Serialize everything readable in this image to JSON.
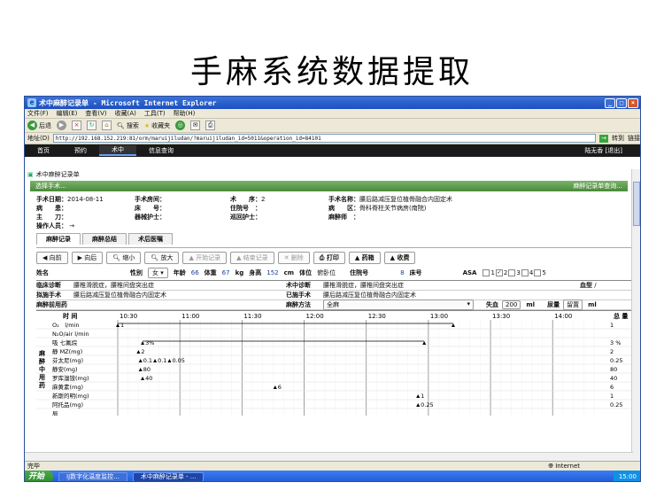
{
  "slide_title": "手麻系统数据提取",
  "window": {
    "title": "术中麻醉记录单 - Microsoft Internet Explorer"
  },
  "menu": [
    "文件(F)",
    "编辑(E)",
    "查看(V)",
    "收藏(A)",
    "工具(T)",
    "帮助(H)"
  ],
  "toolbar": {
    "back": "后退",
    "search": "搜索",
    "favorites": "收藏夹"
  },
  "address": {
    "label": "地址(D)",
    "url": "http://192.168.152.219:81/orm/maruijiludan/?maruijiludan_id=5011&operation_id=84101",
    "go": "转到",
    "links": "链接"
  },
  "nav": {
    "items": [
      "首页",
      "预约",
      "术中",
      "信息查询"
    ],
    "active": 2,
    "user": "陆无香 [退出]"
  },
  "breadcrumb": "术中麻醉记录单",
  "select_bar": {
    "left": "选择手术...",
    "right": "麻醉记录单查询..."
  },
  "surgery": {
    "date_label": "手术日期：",
    "date": "2014-08-11",
    "room_label": "手术房间：",
    "seq_label": "术　　序：",
    "seq": "2",
    "name_label": "手术名称：",
    "name": "腰后路减压复位植骨融合内固定术",
    "ward_label": "病　　患：",
    "bed_label": "床　　号：",
    "inpatient_label": "住院号　：",
    "area_label": "病　　区：",
    "area": "骨科脊柱关节病房(南院)",
    "surgeon_label": "主　　刀：",
    "instr_nurse_label": "器械护士：",
    "circ_nurse_label": "巡回护士：",
    "anes_label": "麻醉师　：",
    "operator_label": "操作人员：",
    "operator": "→"
  },
  "tabs": [
    "麻醉记录",
    "麻醉总结",
    "术后医嘱"
  ],
  "buttons": [
    "向前",
    "向后",
    "缩小",
    "放大",
    "开始记录",
    "结束记录",
    "删除",
    "打印",
    "药箱",
    "收费"
  ],
  "patient": {
    "name_label": "姓名",
    "sex_label": "性别",
    "sex": "女",
    "age_label": "年龄",
    "age": "66",
    "weight_label": "体重",
    "weight": "67",
    "weight_unit": "kg",
    "height_label": "身高",
    "height": "152",
    "height_unit": "cm",
    "pos_label": "体位",
    "pos": "俯卧位",
    "inp_label": "住院号",
    "bed_no": "8",
    "bed_label": "床号",
    "asa_label": "ASA",
    "asa_opts": [
      "1",
      "2",
      "3",
      "4",
      "5"
    ]
  },
  "diag": {
    "pre_label": "临床诊断",
    "pre": "腰椎滑脱症，腰椎间盘突出症",
    "intra_label": "术中诊断",
    "intra": "腰椎滑脱症，腰椎间盘突出症",
    "blood_label": "血型",
    "blood": "/",
    "planned_label": "拟施手术",
    "planned": "腰后路减压复位植骨融合内固定术",
    "done_label": "已施手术",
    "done": "腰后路减压复位植骨融合内固定术",
    "drug_label": "麻醉前用药",
    "method_label": "麻醉方法",
    "method": "全麻",
    "loss_label": "失血",
    "loss": "200",
    "loss_unit": "ml",
    "urine_label": "尿量",
    "urine": "留置",
    "urine_unit": "ml"
  },
  "chart_data": {
    "type": "timeline",
    "times": [
      "10:30",
      "11:00",
      "11:30",
      "12:00",
      "12:30",
      "13:00",
      "13:30",
      "14:00"
    ],
    "time_label": "时 间",
    "total_label": "总 量",
    "side_label": [
      "麻",
      "醉",
      "中",
      "用",
      "药"
    ],
    "rows": [
      {
        "label": "O₂　l/min",
        "total": "1"
      },
      {
        "label": "N₂O/air l/min",
        "total": ""
      },
      {
        "label": "吸 七氟烷",
        "total": "3 %"
      },
      {
        "label": "静 MZ(mg)",
        "total": "2"
      },
      {
        "label": "芬太尼(mg)",
        "total": "0.25"
      },
      {
        "label": "静安(mg)",
        "total": "80"
      },
      {
        "label": "罗库溴铵(mg)",
        "total": "40"
      },
      {
        "label": "麻黄素(mg)",
        "total": "6"
      },
      {
        "label": "新斯的明(mg)",
        "total": "1"
      },
      {
        "label": "阿托品(mg)",
        "total": "0.25"
      },
      {
        "label": "局",
        "total": ""
      }
    ],
    "events": [
      {
        "row": 0,
        "time": "10:30",
        "label": "1"
      },
      {
        "row": 0,
        "time": "13:12",
        "label": ""
      },
      {
        "row": 2,
        "time": "10:42",
        "label": "3%"
      },
      {
        "row": 2,
        "time": "12:58",
        "label": ""
      },
      {
        "row": 3,
        "time": "10:40",
        "label": "2"
      },
      {
        "row": 4,
        "time": "10:41",
        "label": "0.1"
      },
      {
        "row": 4,
        "time": "10:48",
        "label": "0.1"
      },
      {
        "row": 4,
        "time": "10:55",
        "label": "0.05"
      },
      {
        "row": 5,
        "time": "10:41",
        "label": "80"
      },
      {
        "row": 6,
        "time": "10:42",
        "label": "40"
      },
      {
        "row": 7,
        "time": "11:46",
        "label": "6"
      },
      {
        "row": 8,
        "time": "12:55",
        "label": "1"
      },
      {
        "row": 9,
        "time": "12:55",
        "label": "0.25"
      }
    ]
  },
  "status": {
    "left": "完毕",
    "zone": "Internet"
  },
  "taskbar": {
    "start": "开始",
    "tasks": [
      "IJ数字化温度监控...",
      "术中麻醉记录单 - ..."
    ],
    "clock": "15:00"
  },
  "colors": {
    "titlebar": "#1c4fbf",
    "nav": "#1a1a1a",
    "bar": "#4a8a3a"
  }
}
